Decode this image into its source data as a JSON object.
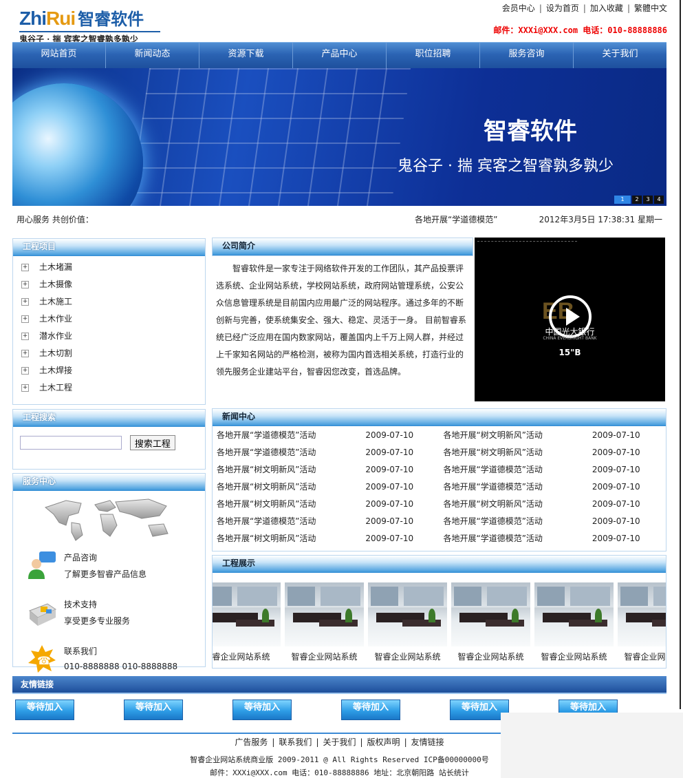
{
  "header": {
    "logo_en_a": "Zhi",
    "logo_en_b": "Rui",
    "logo_cn": "智睿软件",
    "tagline": "鬼谷子 · 揣   宾客之智睿孰多孰少",
    "top_links": [
      "会员中心",
      "设为首页",
      "加入收藏",
      "繁體中文"
    ],
    "contact": "邮件：XXXi@XXX.com 电话：010-88888886"
  },
  "nav": [
    "网站首页",
    "新闻动态",
    "资源下载",
    "产品中心",
    "职位招聘",
    "服务咨询",
    "关于我们"
  ],
  "banner": {
    "title": "智睿软件",
    "subtitle": "鬼谷子 · 揣 宾客之智睿孰多孰少",
    "pager": [
      "1",
      "2",
      "3",
      "4"
    ]
  },
  "ticker": {
    "left": "用心服务 共创价值：",
    "middle": "各地开展“学道德模范”",
    "datetime": "2012年3月5日 17:38:31 星期一"
  },
  "projects": {
    "title": "工程项目",
    "items": [
      "土木堵漏",
      "土木摄像",
      "土木施工",
      "土木作业",
      "潜水作业",
      "土木切割",
      "土木焊接",
      "土木工程"
    ]
  },
  "project_search": {
    "title": "工程搜索",
    "input_value": "",
    "button": "搜索工程"
  },
  "service": {
    "title": "服务中心",
    "items": [
      {
        "a": "产品咨询",
        "b": "了解更多智睿产品信息",
        "icon": "consult-icon"
      },
      {
        "a": "技术支持",
        "b": "享受更多专业服务",
        "icon": "support-icon"
      },
      {
        "a": "联系我们",
        "b": "010-8888888 010-8888888",
        "icon": "phone-icon"
      }
    ]
  },
  "intro": {
    "title": "公司简介",
    "text": "智睿软件是一家专注于网络软件开发的工作团队，其产品投票评选系统、企业网站系统，学校网站系统，政府网站管理系统，公安公众信息管理系统是目前国内应用最广泛的网站程序。通过多年的不断创新与完善，使系统集安全、强大、稳定、灵活于一身。 目前智睿系统已经广泛应用在国内数家网站，覆盖国内上千万上网人群，并经过上千家知名网站的严格检测，被称为国内首选相关系统，打造行业的领先服务企业建站平台，智睿因您改变，首选品牌。"
  },
  "video": {
    "bank_cn": "中国光大银行",
    "bank_en": "CHINA EVERBRIGHT BANK",
    "duration": "15\"B"
  },
  "news": {
    "title": "新闻中心",
    "rows": [
      [
        "各地开展“学道德模范”活动",
        "2009-07-10",
        "各地开展“树文明新风”活动",
        "2009-07-10"
      ],
      [
        "各地开展“学道德模范”活动",
        "2009-07-10",
        "各地开展“树文明新风”活动",
        "2009-07-10"
      ],
      [
        "各地开展“树文明新风”活动",
        "2009-07-10",
        "各地开展“学道德模范”活动",
        "2009-07-10"
      ],
      [
        "各地开展“树文明新风”活动",
        "2009-07-10",
        "各地开展“学道德模范”活动",
        "2009-07-10"
      ],
      [
        "各地开展“树文明新风”活动",
        "2009-07-10",
        "各地开展“树文明新风”活动",
        "2009-07-10"
      ],
      [
        "各地开展“学道德模范”活动",
        "2009-07-10",
        "各地开展“学道德模范”活动",
        "2009-07-10"
      ],
      [
        "各地开展“树文明新风”活动",
        "2009-07-10",
        "各地开展“学道德模范”活动",
        "2009-07-10"
      ]
    ]
  },
  "showcase": {
    "title": "工程展示",
    "captions": [
      "睿企业网站系统",
      "智睿企业网站系统",
      "智睿企业网站系统",
      "智睿企业网站系统",
      "智睿企业网站系统",
      "智睿企业网站系统"
    ]
  },
  "friends": {
    "title": "友情链接",
    "items": [
      "等待加入",
      "等待加入",
      "等待加入",
      "等待加入",
      "等待加入",
      "等待加入"
    ]
  },
  "footer": {
    "links": [
      "广告服务",
      "联系我们",
      "关于我们",
      "版权声明",
      "友情链接"
    ],
    "copyright": "智睿企业网站系统商业版 2009-2011 @ All Rights Reserved ICP备00000000号",
    "address": "邮件：XXXi@XXX.com 电话：010-88888886   地址：北京朝阳路 站长统计"
  }
}
